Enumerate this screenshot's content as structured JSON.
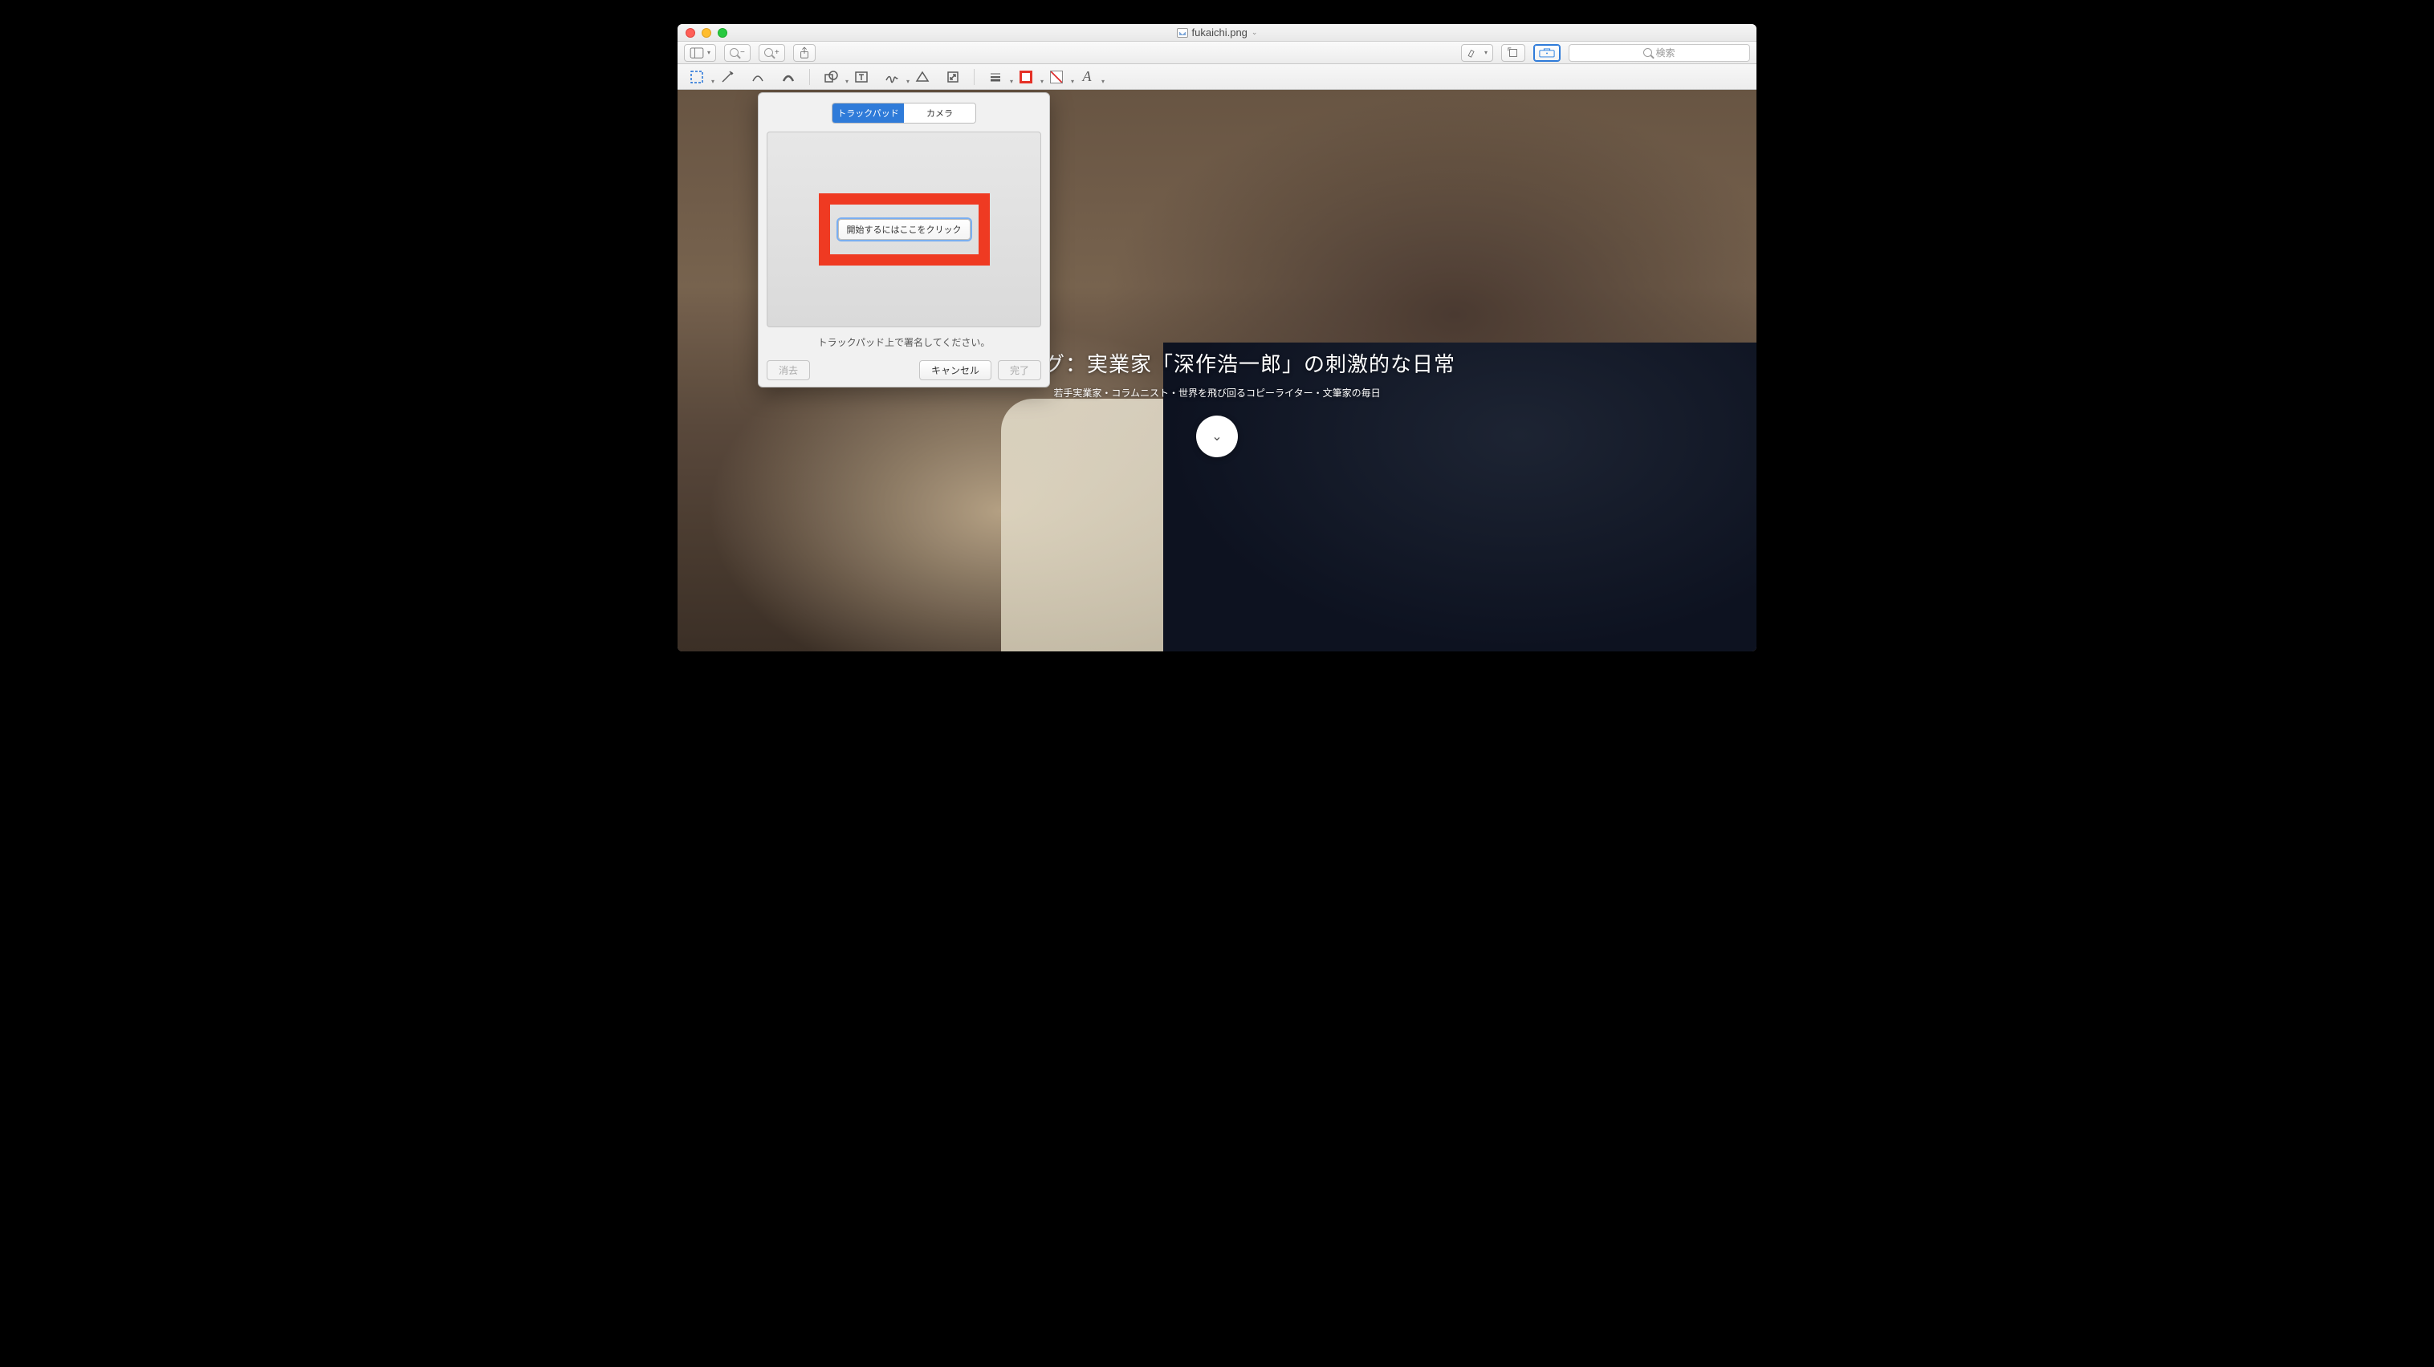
{
  "window": {
    "filename": "fukaichi.png"
  },
  "toolbar": {
    "search_placeholder": "検索"
  },
  "popover": {
    "tab_trackpad": "トラックパッド",
    "tab_camera": "カメラ",
    "start_label": "開始するにはここをクリック",
    "hint": "トラックパッド上で署名してください。",
    "clear": "消去",
    "cancel": "キャンセル",
    "done": "完了"
  },
  "hero": {
    "title": "チブログ：実業家「深作浩一郎」の刺激的な日常",
    "subtitle": "若手実業家・コラムニスト・世界を飛び回るコピーライター・文筆家の毎日"
  },
  "colors": {
    "highlight_border": "#ef3a22",
    "accent": "#2f7bd9"
  }
}
